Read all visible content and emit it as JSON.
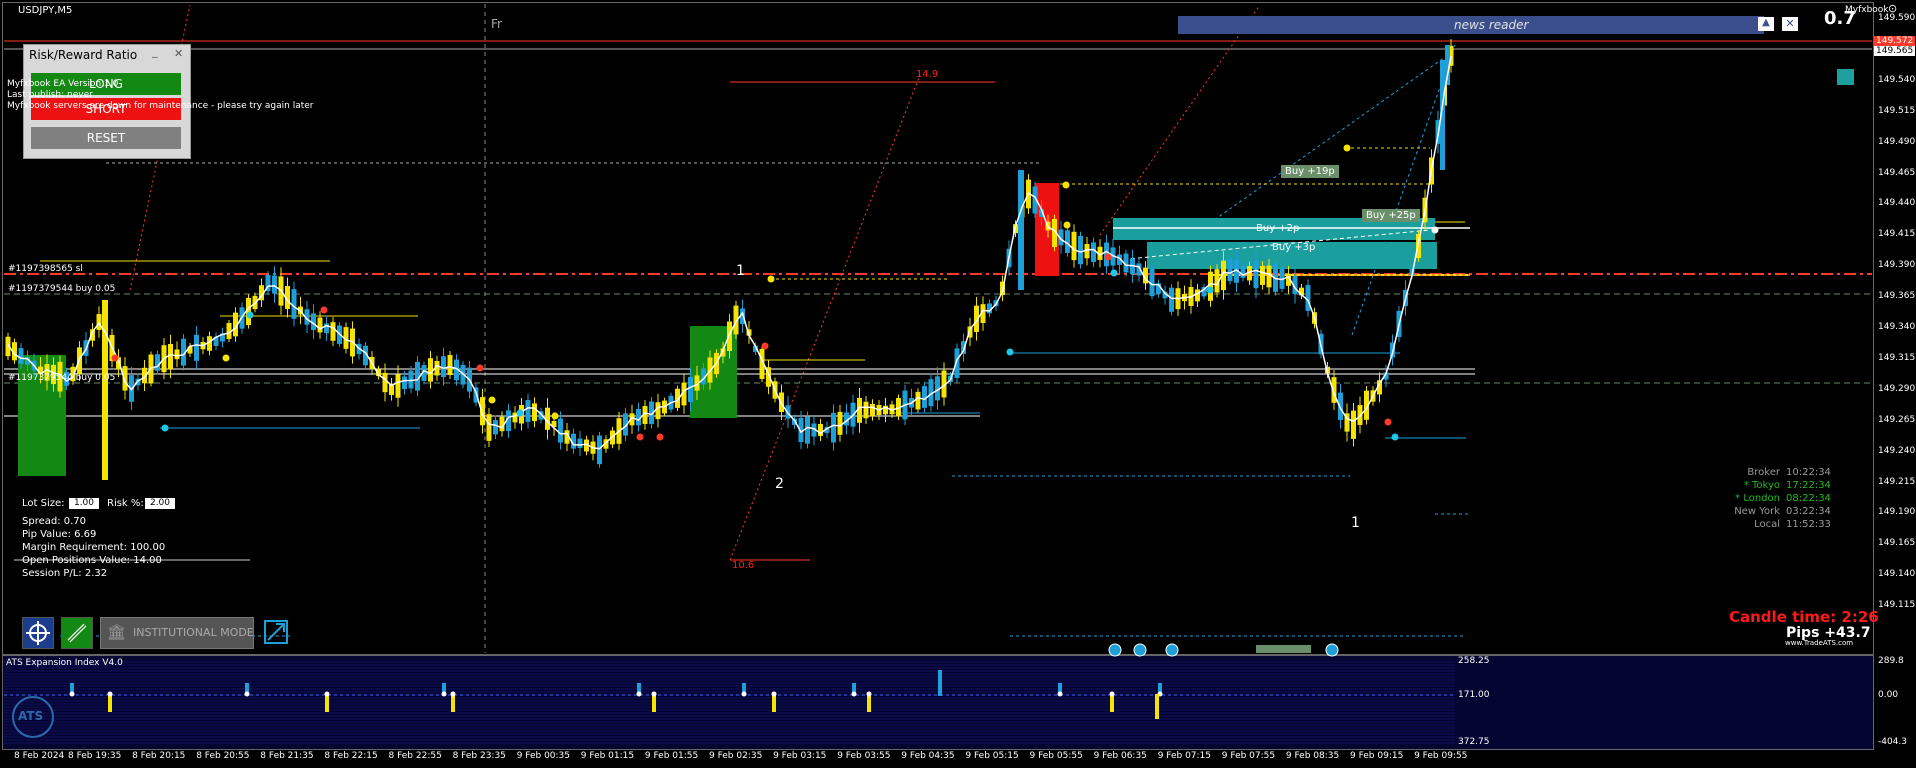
{
  "window": {
    "symbol": "USDJPY,M5",
    "day_marker": "Fr",
    "logo_text": "Myfxbook",
    "big_value": "0.7"
  },
  "news_reader": {
    "title": "news reader"
  },
  "risk_reward": {
    "title": "Risk/Reward Ratio",
    "minimize": "_",
    "close": "✕",
    "long_label": "LONG",
    "short_label": "SHORT",
    "reset_label": "RESET"
  },
  "myfxbook_notice": {
    "line1": "Myfxbook EA Version 1.0",
    "line2": "Last publish: never",
    "line3": "Myfxbook servers are down for maintenance - please try again later"
  },
  "order_lines": {
    "sl": "#1197398565 sl",
    "buy1": "#1197379544 buy 0.05",
    "buy2": "#1197379544 buy 0.05"
  },
  "wave_labels": [
    "1",
    "2",
    "1",
    "2"
  ],
  "level_labels": {
    "upper": "14.9",
    "lower": "10.6"
  },
  "trade_labels": [
    "Buy +19p",
    "Buy +25p",
    "Buy +2p",
    "Buy +3p"
  ],
  "trade_panel": {
    "lot_label": "Lot Size:",
    "lot_value": "1.00",
    "risk_label": "Risk %:",
    "risk_value": "2.00",
    "spread": "Spread: 0.70",
    "pip_value": "Pip Value: 6.69",
    "margin": "Margin Requirement: 100.00",
    "open_pos": "Open Positions Value: 14.00",
    "session": "Session P/L: 2.32"
  },
  "toolbar": {
    "institutional": "INSTITUTIONAL MODE"
  },
  "clocks": [
    {
      "name": "Broker",
      "time": "10:22:34",
      "color": "#9a9a9a"
    },
    {
      "name": "* Tokyo",
      "time": "17:22:34",
      "color": "#22bb22"
    },
    {
      "name": "* London",
      "time": "08:22:34",
      "color": "#22bb22"
    },
    {
      "name": "New York",
      "time": "03:22:34",
      "color": "#9a9a9a"
    },
    {
      "name": "Local",
      "time": "11:52:33",
      "color": "#9a9a9a"
    }
  ],
  "candle_time": "Candle time:  2:26",
  "pips": "Pips +43.7",
  "site": "www.TradeATS.com",
  "price_axis": [
    "149.590",
    "149.565",
    "149.540",
    "149.515",
    "149.490",
    "149.465",
    "149.440",
    "149.415",
    "149.390",
    "149.365",
    "149.340",
    "149.315",
    "149.290",
    "149.265",
    "149.240",
    "149.215",
    "149.190",
    "149.165",
    "149.140",
    "149.115"
  ],
  "price_tags": {
    "red": "149.572",
    "white": "149.565"
  },
  "indicator": {
    "name": "ATS Expansion Index V4.0",
    "left_values": [
      "258.25",
      "171.00",
      "372.75"
    ],
    "right_values": [
      "289.8",
      "0.00",
      "-404.3"
    ]
  },
  "time_axis": [
    "8 Feb 2024",
    "8 Feb 19:35",
    "8 Feb 20:15",
    "8 Feb 20:55",
    "8 Feb 21:35",
    "8 Feb 22:15",
    "8 Feb 22:55",
    "8 Feb 23:35",
    "9 Feb 00:35",
    "9 Feb 01:15",
    "9 Feb 01:55",
    "9 Feb 02:35",
    "9 Feb 03:15",
    "9 Feb 03:55",
    "9 Feb 04:35",
    "9 Feb 05:15",
    "9 Feb 05:55",
    "9 Feb 06:35",
    "9 Feb 07:15",
    "9 Feb 07:55",
    "9 Feb 08:35",
    "9 Feb 09:15",
    "9 Feb 09:55"
  ],
  "colors": {
    "bull": "#1e9fd8",
    "bear": "#f5e400",
    "bg": "#000000",
    "grid": "#333333",
    "ma": "#ffffff",
    "panel_bg": "#0a0a3c"
  }
}
